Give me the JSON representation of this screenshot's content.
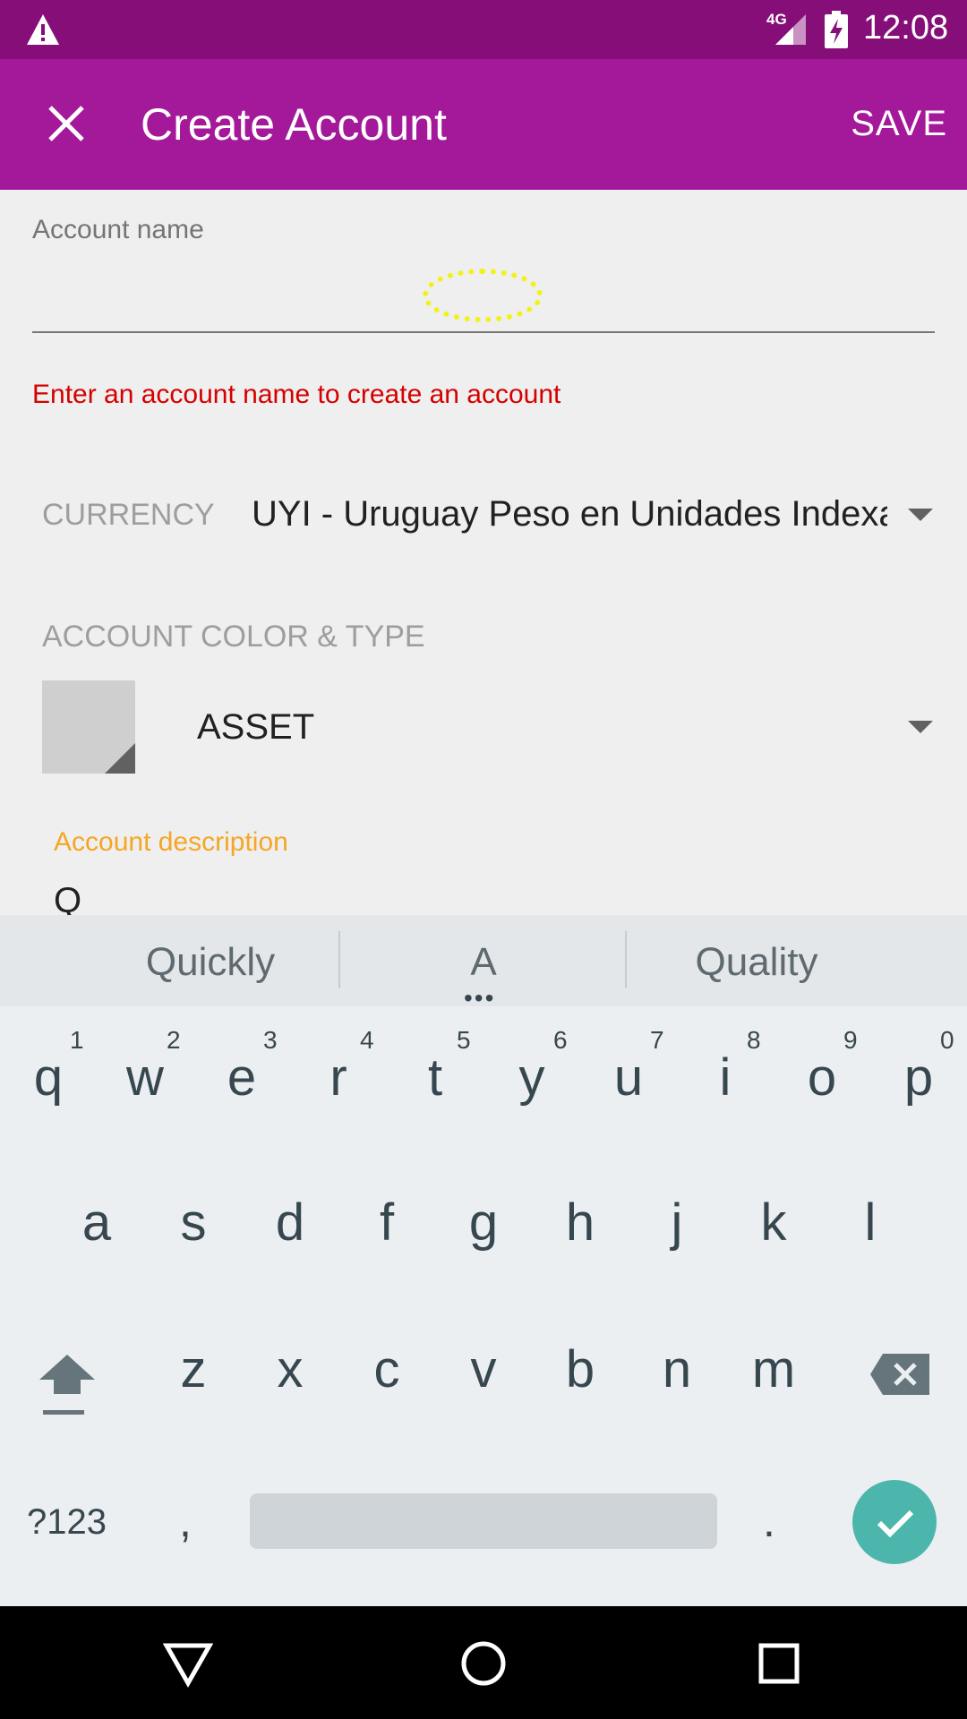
{
  "status_bar": {
    "time": "12:08",
    "network": "4G",
    "icons": [
      "warning-icon",
      "signal-icon",
      "battery-charging-icon"
    ]
  },
  "toolbar": {
    "title": "Create Account",
    "save_label": "SAVE",
    "close_icon": "close-icon",
    "background": "#a4189a"
  },
  "form": {
    "account_name_label": "Account name",
    "account_name_value": "",
    "account_name_error": "Enter an account name to create an account",
    "currency_label": "CURRENCY",
    "currency_value": "UYI - Uruguay Peso en Unidades Indexadas",
    "color_type_label": "ACCOUNT COLOR & TYPE",
    "account_type_value": "ASSET",
    "description_label": "Account description",
    "description_value": "Q"
  },
  "keyboard": {
    "suggestions": [
      "Quickly",
      "A",
      "Quality"
    ],
    "rows": [
      [
        "q",
        "w",
        "e",
        "r",
        "t",
        "y",
        "u",
        "i",
        "o",
        "p"
      ],
      [
        "a",
        "s",
        "d",
        "f",
        "g",
        "h",
        "j",
        "k",
        "l"
      ],
      [
        "z",
        "x",
        "c",
        "v",
        "b",
        "n",
        "m"
      ]
    ],
    "number_hints": [
      "1",
      "2",
      "3",
      "4",
      "5",
      "6",
      "7",
      "8",
      "9",
      "0"
    ],
    "symbols_label": "?123",
    "comma_label": ",",
    "period_label": ".",
    "accent_color": "#4db6ac"
  },
  "nav_bar": {
    "buttons": [
      "back-icon",
      "home-icon",
      "recents-icon"
    ]
  }
}
